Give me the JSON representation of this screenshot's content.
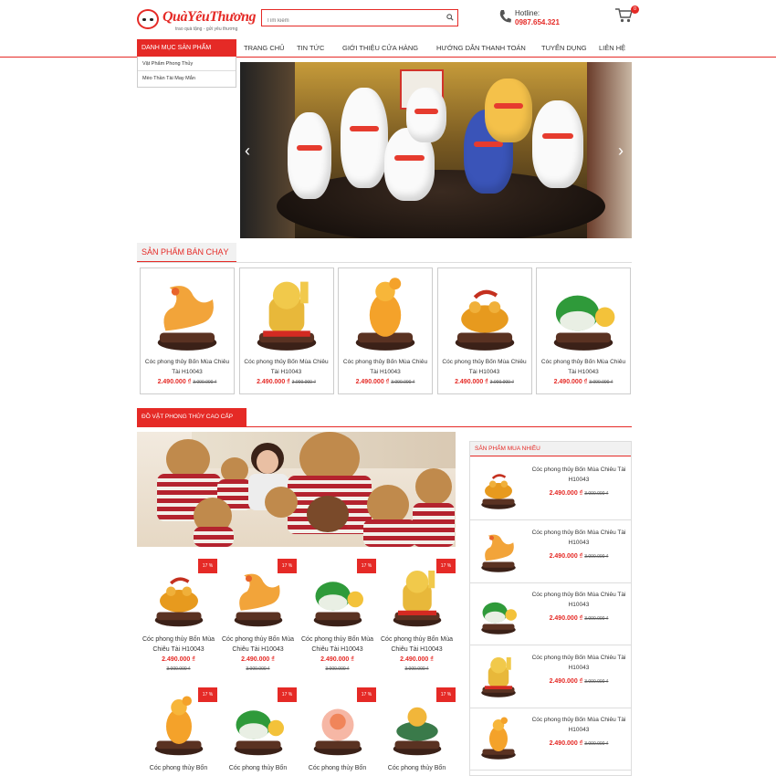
{
  "header": {
    "logo_text": "QuàYêuThương",
    "logo_slogan": "trao quà tặng - gửi yêu thương",
    "search_placeholder": "Tìm kiếm",
    "hotline_label": "Hotline:",
    "hotline_number": "0987.654.321",
    "cart_count": "0"
  },
  "nav": {
    "category_button": "DANH MỤC SẢN PHẨM",
    "category_items": [
      "Vật Phẩm Phong Thủy",
      "Mèo Thần Tài May Mắn"
    ],
    "menu": [
      "TRANG CHỦ",
      "TIN TỨC",
      "GIỚI THIỆU CỬA HÀNG",
      "HƯỚNG DẪN THANH TOÁN",
      "TUYỂN DỤNG",
      "LIÊN HỆ"
    ]
  },
  "banner": {
    "prev": "‹",
    "next": "›"
  },
  "bestseller": {
    "title": "SẢN PHẨM BÁN CHẠY",
    "products": [
      {
        "name": "Cóc phong thủy Bốn Mùa Chiêu Tài H10043",
        "price": "2.490.000 ₫",
        "old_price": "3.000.000 ₫",
        "icon": "dragon-figurine"
      },
      {
        "name": "Cóc phong thủy Bốn Mùa Chiêu Tài H10043",
        "price": "2.490.000 ₫",
        "old_price": "3.000.000 ₫",
        "icon": "lucky-cat"
      },
      {
        "name": "Cóc phong thủy Bốn Mùa Chiêu Tài H10043",
        "price": "2.490.000 ₫",
        "old_price": "3.000.000 ₫",
        "icon": "buddha-figurine"
      },
      {
        "name": "Cóc phong thủy Bốn Mùa Chiêu Tài H10043",
        "price": "2.490.000 ₫",
        "old_price": "3.000.000 ₫",
        "icon": "toad-figurine"
      },
      {
        "name": "Cóc phong thủy Bốn Mùa Chiêu Tài H10043",
        "price": "2.490.000 ₫",
        "old_price": "3.000.000 ₫",
        "icon": "cabbage-figurine"
      }
    ]
  },
  "premium": {
    "title": "ĐỒ VẬT PHONG THỦY CAO CẤP",
    "products": [
      {
        "name": "Cóc phong thủy Bốn Mùa Chiêu Tài H10043",
        "price": "2.490.000 ₫",
        "old_price": "3.000.000 ₫",
        "discount": "17 %"
      },
      {
        "name": "Cóc phong thủy Bốn Mùa Chiêu Tài H10043",
        "price": "2.490.000 ₫",
        "old_price": "3.000.000 ₫",
        "discount": "17 %"
      },
      {
        "name": "Cóc phong thủy Bốn Mùa Chiêu Tài H10043",
        "price": "2.490.000 ₫",
        "old_price": "3.000.000 ₫",
        "discount": "17 %"
      },
      {
        "name": "Cóc phong thủy Bốn Mùa Chiêu Tài H10043",
        "price": "2.490.000 ₫",
        "old_price": "3.000.000 ₫",
        "discount": "17 %"
      },
      {
        "name": "Cóc phong thủy Bốn",
        "price": "",
        "old_price": "",
        "discount": "17 %"
      },
      {
        "name": "Cóc phong thủy Bốn",
        "price": "",
        "old_price": "",
        "discount": "17 %"
      },
      {
        "name": "Cóc phong thủy Bốn",
        "price": "",
        "old_price": "",
        "discount": "17 %"
      },
      {
        "name": "Cóc phong thủy Bốn",
        "price": "",
        "old_price": "",
        "discount": "17 %"
      }
    ]
  },
  "sidebar": {
    "title": "SẢN PHẨM MUA NHIỀU",
    "products": [
      {
        "name": "Cóc phong thủy Bốn Mùa Chiêu Tài H10043",
        "price": "2.490.000 ₫",
        "old_price": "3.000.000 ₫"
      },
      {
        "name": "Cóc phong thủy Bốn Mùa Chiêu Tài H10043",
        "price": "2.490.000 ₫",
        "old_price": "3.000.000 ₫"
      },
      {
        "name": "Cóc phong thủy Bốn Mùa Chiêu Tài H10043",
        "price": "2.490.000 ₫",
        "old_price": "3.000.000 ₫"
      },
      {
        "name": "Cóc phong thủy Bốn Mùa Chiêu Tài H10043",
        "price": "2.490.000 ₫",
        "old_price": "3.000.000 ₫"
      },
      {
        "name": "Cóc phong thủy Bốn Mùa Chiêu Tài H10043",
        "price": "2.490.000 ₫",
        "old_price": "3.000.000 ₫"
      }
    ]
  },
  "colors": {
    "accent": "#e52a26",
    "gold": "#f2b632",
    "jade": "#2f9a3a",
    "wood": "#4a2a1e"
  }
}
